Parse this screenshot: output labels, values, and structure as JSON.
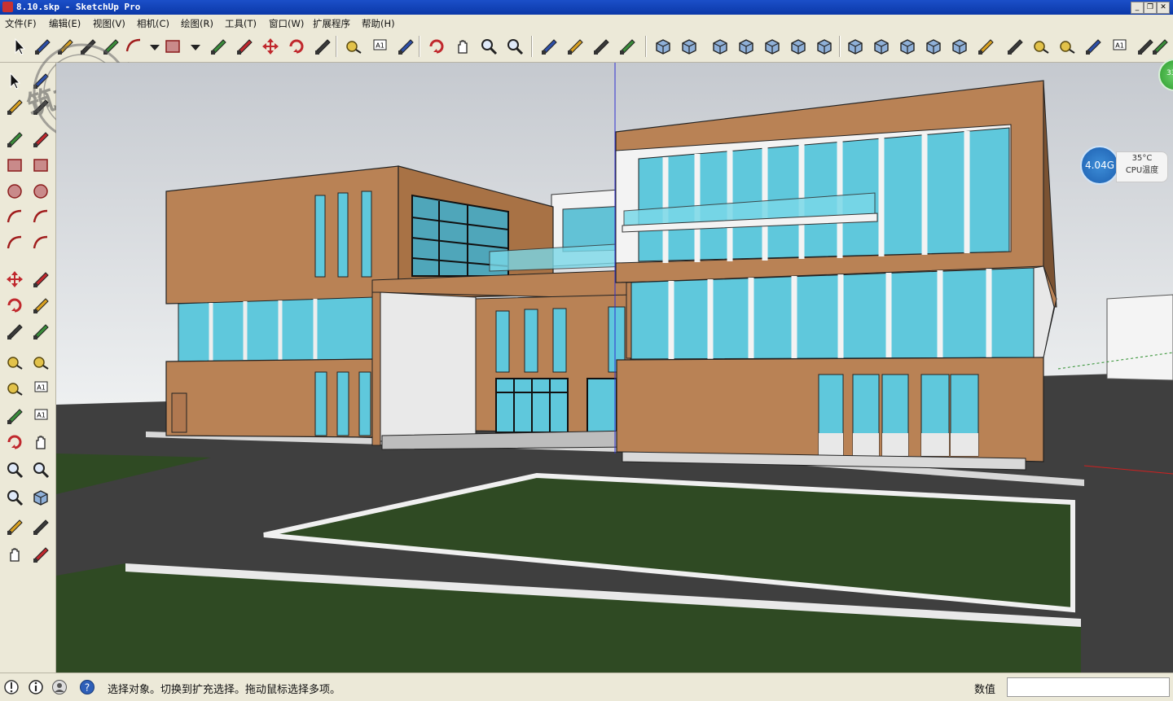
{
  "window": {
    "title": "8.10.skp - SketchUp Pro",
    "controls": [
      "_",
      "❐",
      "✕"
    ]
  },
  "menu": [
    "文件(F)",
    "编辑(E)",
    "视图(V)",
    "相机(C)",
    "绘图(R)",
    "工具(T)",
    "窗口(W)",
    "扩展程序",
    "帮助(H)"
  ],
  "toolbar_icons": [
    "select-icon",
    "eraser-icon",
    "paint-icon",
    "line-icon",
    "freehand-icon",
    "arc-icon",
    "dropdown-icon",
    "rectangle-icon",
    "dropdown-icon",
    "push-pull-icon",
    "follow-me-icon",
    "move-icon",
    "rotate-icon",
    "scale-icon",
    "tape-measure-icon",
    "text-icon",
    "paint-bucket-icon",
    "orbit-icon",
    "pan-icon",
    "zoom-icon",
    "zoom-extents-icon",
    "warehouse-icon",
    "extension-icon",
    "ruby-icon",
    "layout-icon",
    "iso-view-icon",
    "top-view-icon",
    "front-view-icon",
    "right-view-icon",
    "back-view-icon",
    "left-view-icon",
    "xray-icon",
    "wireframe-icon",
    "hidden-line-icon",
    "shaded-icon",
    "shaded-texture-icon",
    "monochrome-icon",
    "sandbox-icon",
    "section-icon",
    "dimension-icon",
    "protractor-icon",
    "axes-icon",
    "3d-text-icon",
    "tool-a-icon",
    "tool-b-icon",
    "tool-c-icon",
    "tool-d-icon"
  ],
  "sidebar_icons": [
    "select-icon",
    "component-icon",
    "paint-bucket-icon",
    "eraser-icon",
    "line-icon",
    "freehand-icon",
    "rectangle-icon",
    "rotated-rectangle-icon",
    "circle-icon",
    "polygon-icon",
    "arc-icon",
    "pie-icon",
    "3pt-arc-icon",
    "2pt-arc-icon",
    "move-icon",
    "push-pull-icon",
    "rotate-icon",
    "follow-me-icon",
    "scale-icon",
    "offset-icon",
    "tape-measure-icon",
    "dimension-icon",
    "protractor-icon",
    "text-icon",
    "axes-icon",
    "3d-text-icon",
    "orbit-icon",
    "pan-icon",
    "zoom-icon",
    "zoom-window-icon",
    "zoom-extents-icon",
    "previous-view-icon",
    "position-camera-icon",
    "look-around-icon",
    "walk-icon",
    "section-plane-icon"
  ],
  "watermark": "筑龙教育",
  "widget": {
    "memory": "4.04G",
    "cpu_temp": "35°C",
    "cpu_label": "CPU温度"
  },
  "green_badge": "33",
  "status": {
    "message": "选择对象。切换到扩充选择。拖动鼠标选择多项。",
    "measurement_label": "数值",
    "measurement_value": ""
  },
  "colors": {
    "facade": "#b98255",
    "glass": "#5fc8dc",
    "road": "#3f3f3f",
    "lawn": "#2f4a23",
    "sky_top": "#c8ccd2",
    "sky_bottom": "#eceeef"
  }
}
